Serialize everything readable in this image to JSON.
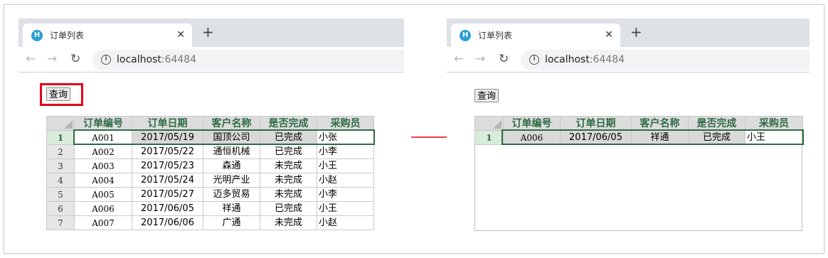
{
  "browser": {
    "tab_title": "订单列表",
    "favicon_letter": "H",
    "url_host": "localhost",
    "url_port": ":64484",
    "close_glyph": "✕",
    "newtab_glyph": "+"
  },
  "query_button": "查询",
  "columns": [
    "订单编号",
    "订单日期",
    "客户名称",
    "是否完成",
    "采购员"
  ],
  "left_rows": [
    {
      "num": "1",
      "code": "A001",
      "date": "2017/05/19",
      "customer": "国顶公司",
      "done": "已完成",
      "buyer": "小张"
    },
    {
      "num": "2",
      "code": "A002",
      "date": "2017/05/22",
      "customer": "通恒机械",
      "done": "已完成",
      "buyer": "小李"
    },
    {
      "num": "3",
      "code": "A003",
      "date": "2017/05/23",
      "customer": "森通",
      "done": "未完成",
      "buyer": "小王"
    },
    {
      "num": "4",
      "code": "A004",
      "date": "2017/05/24",
      "customer": "光明产业",
      "done": "未完成",
      "buyer": "小赵"
    },
    {
      "num": "5",
      "code": "A005",
      "date": "2017/05/27",
      "customer": "迈多贸易",
      "done": "未完成",
      "buyer": "小李"
    },
    {
      "num": "6",
      "code": "A006",
      "date": "2017/06/05",
      "customer": "祥通",
      "done": "已完成",
      "buyer": "小王"
    },
    {
      "num": "7",
      "code": "A007",
      "date": "2017/06/06",
      "customer": "广通",
      "done": "未完成",
      "buyer": "小赵"
    }
  ],
  "right_rows": [
    {
      "num": "1",
      "code": "A006",
      "date": "2017/06/05",
      "customer": "祥通",
      "done": "已完成",
      "buyer": "小王"
    }
  ],
  "colors": {
    "highlight": "#e2001a",
    "header_text": "#2e6b44",
    "arrow": "#e2001a"
  }
}
